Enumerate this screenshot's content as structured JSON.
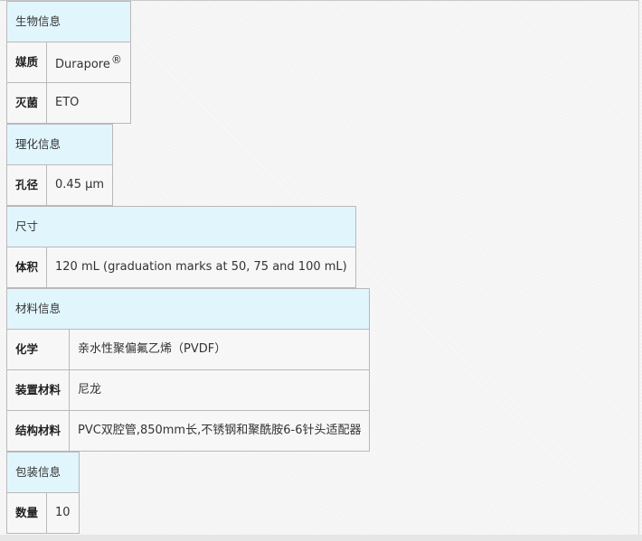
{
  "sections": [
    {
      "header": "生物信息",
      "rows": [
        {
          "label": "媒质",
          "value": "Durapore",
          "suffix": "®"
        },
        {
          "label": "灭菌",
          "value": "ETO"
        }
      ]
    },
    {
      "header": "理化信息",
      "rows": [
        {
          "label": "孔径",
          "value": "0.45 µm"
        }
      ]
    },
    {
      "header": "尺寸",
      "rows": [
        {
          "label": "体积",
          "value": "120 mL (graduation marks at 50, 75 and 100 mL)"
        }
      ]
    },
    {
      "header": "材料信息",
      "rows": [
        {
          "label": "化学",
          "value": "亲水性聚偏氟乙烯（PVDF）"
        },
        {
          "label": "装置材料",
          "value": "尼龙"
        },
        {
          "label": "结构材料",
          "value": "PVC双腔管,850mm长,不锈钢和聚酰胺6-6针头适配器"
        }
      ]
    },
    {
      "header": "包装信息",
      "rows": [
        {
          "label": "数量",
          "value": "10"
        }
      ]
    }
  ],
  "colors": {
    "header_bg": "#e1f5fd",
    "cell_bg": "#f7f7f7",
    "border": "#b9b9b9"
  }
}
